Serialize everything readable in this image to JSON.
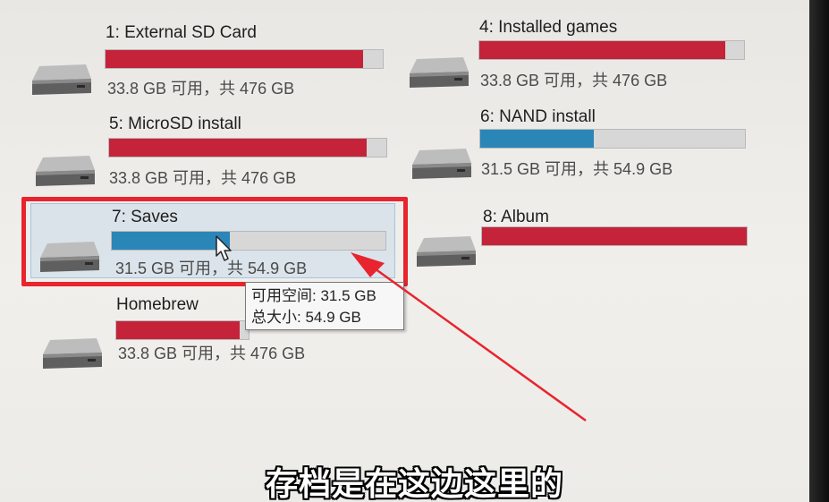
{
  "colors": {
    "bar_normal": "#c4233a",
    "bar_low_usage": "#2b86b8",
    "annotation": "#e8242e"
  },
  "drives": [
    {
      "name": "1: External SD Card",
      "space": "33.8 GB 可用，共 476 GB",
      "used_fraction": 0.93,
      "bar_color": "#c4233a",
      "icon": "drive-icon",
      "highlighted": false
    },
    {
      "name": "4: Installed games",
      "space": "33.8 GB 可用，共 476 GB",
      "used_fraction": 0.93,
      "bar_color": "#c4233a",
      "icon": "drive-icon",
      "highlighted": false
    },
    {
      "name": "5: MicroSD install",
      "space": "33.8 GB 可用，共 476 GB",
      "used_fraction": 0.93,
      "bar_color": "#c4233a",
      "icon": "drive-icon",
      "highlighted": false
    },
    {
      "name": "6: NAND install",
      "space": "31.5 GB 可用，共 54.9 GB",
      "used_fraction": 0.43,
      "bar_color": "#2b86b8",
      "icon": "drive-icon",
      "highlighted": false
    },
    {
      "name": "7: Saves",
      "space": "31.5 GB 可用，共 54.9 GB",
      "used_fraction": 0.43,
      "bar_color": "#2b86b8",
      "icon": "drive-icon",
      "highlighted": true
    },
    {
      "name": "8: Album",
      "space": "",
      "used_fraction": 1.0,
      "bar_color": "#c4233a",
      "icon": "drive-icon",
      "highlighted": false
    },
    {
      "name": "Homebrew",
      "space": "33.8 GB 可用，共 476 GB",
      "used_fraction": 0.93,
      "bar_color": "#c4233a",
      "icon": "drive-icon",
      "highlighted": false
    }
  ],
  "tooltip": {
    "free_line": "可用空间: 31.5 GB",
    "total_line": "总大小: 54.9 GB"
  },
  "subtitle": "存档是在这边这里的"
}
